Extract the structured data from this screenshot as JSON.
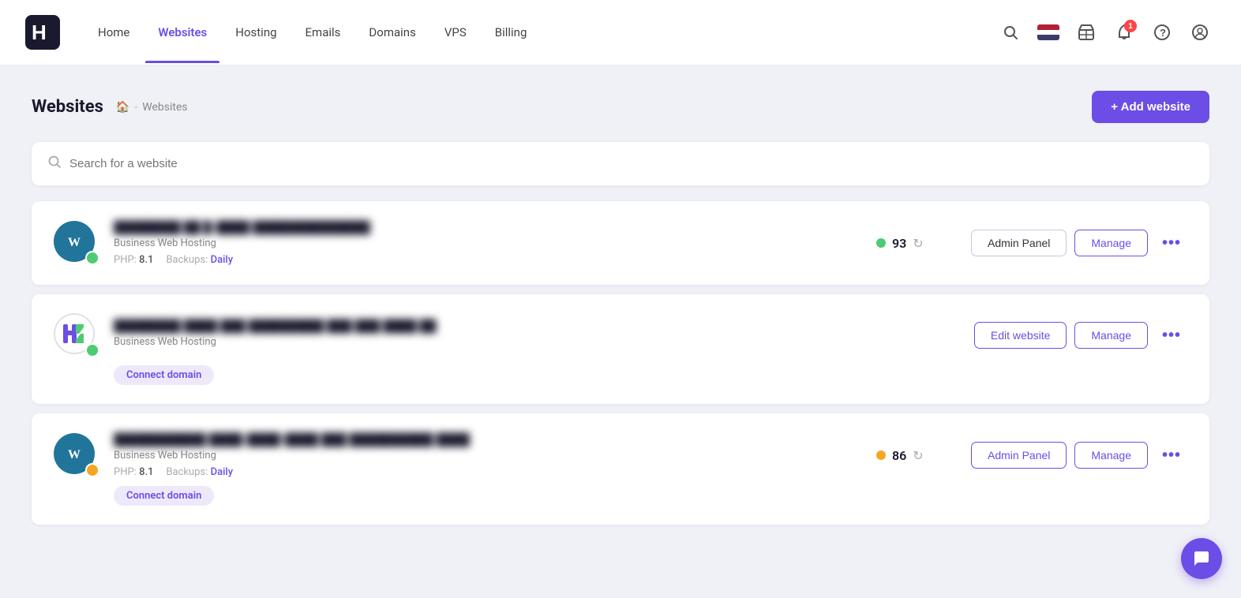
{
  "nav": {
    "logo_text": "H",
    "items": [
      {
        "label": "Home",
        "active": false
      },
      {
        "label": "Websites",
        "active": true
      },
      {
        "label": "Hosting",
        "active": false
      },
      {
        "label": "Emails",
        "active": false
      },
      {
        "label": "Domains",
        "active": false
      },
      {
        "label": "VPS",
        "active": false
      },
      {
        "label": "Billing",
        "active": false
      }
    ],
    "notification_count": "1"
  },
  "page": {
    "title": "Websites",
    "breadcrumb_separator": "-",
    "breadcrumb_label": "Websites",
    "add_btn_label": "+ Add website"
  },
  "search": {
    "placeholder": "Search for a website"
  },
  "websites": [
    {
      "id": "site1",
      "logo_type": "wp",
      "domain": "████████ ██ █-████ ██████████████",
      "hosting_type": "Business Web Hosting",
      "php": "8.1",
      "backups": "Daily",
      "score": "93",
      "score_status": "green",
      "has_score": true,
      "btn1_label": "Admin Panel",
      "btn1_type": "outline",
      "btn2_label": "Manage",
      "btn2_type": "purple",
      "has_connect": false
    },
    {
      "id": "site2",
      "logo_type": "hostinger",
      "domain": "████████ ████ ███ █████████ ███ ███ ████ ██",
      "hosting_type": "Business Web Hosting",
      "php": "",
      "backups": "",
      "score": "",
      "score_status": "",
      "has_score": false,
      "btn1_label": "Edit website",
      "btn1_type": "purple",
      "btn2_label": "Manage",
      "btn2_type": "purple",
      "has_connect": true,
      "connect_label": "Connect domain"
    },
    {
      "id": "site3",
      "logo_type": "wp",
      "domain": "███████████ ████-████-████ ███ ██████████ ████",
      "hosting_type": "Business Web Hosting",
      "php": "8.1",
      "backups": "Daily",
      "score": "86",
      "score_status": "yellow",
      "has_score": true,
      "btn1_label": "Admin Panel",
      "btn1_type": "purple",
      "btn2_label": "Manage",
      "btn2_type": "purple",
      "has_connect": true,
      "connect_label": "Connect domain"
    }
  ],
  "icons": {
    "search": "🔍",
    "home": "🏠",
    "plus": "+",
    "refresh": "↻",
    "more": "•••",
    "chat": "💬"
  },
  "colors": {
    "accent": "#6c4de6",
    "green": "#4ecb71",
    "yellow": "#f5a623",
    "white": "#ffffff"
  }
}
